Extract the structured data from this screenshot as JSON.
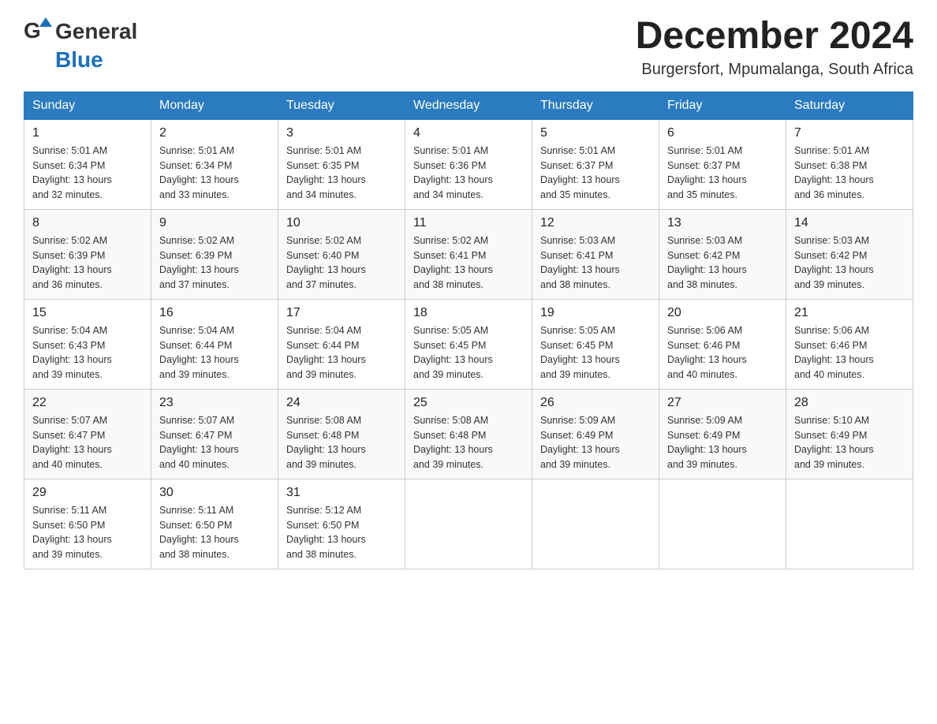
{
  "header": {
    "logo_general": "General",
    "logo_blue": "Blue",
    "month_title": "December 2024",
    "location": "Burgersfort, Mpumalanga, South Africa"
  },
  "weekdays": [
    "Sunday",
    "Monday",
    "Tuesday",
    "Wednesday",
    "Thursday",
    "Friday",
    "Saturday"
  ],
  "weeks": [
    [
      {
        "day": "1",
        "sunrise": "5:01 AM",
        "sunset": "6:34 PM",
        "daylight": "13 hours and 32 minutes."
      },
      {
        "day": "2",
        "sunrise": "5:01 AM",
        "sunset": "6:34 PM",
        "daylight": "13 hours and 33 minutes."
      },
      {
        "day": "3",
        "sunrise": "5:01 AM",
        "sunset": "6:35 PM",
        "daylight": "13 hours and 34 minutes."
      },
      {
        "day": "4",
        "sunrise": "5:01 AM",
        "sunset": "6:36 PM",
        "daylight": "13 hours and 34 minutes."
      },
      {
        "day": "5",
        "sunrise": "5:01 AM",
        "sunset": "6:37 PM",
        "daylight": "13 hours and 35 minutes."
      },
      {
        "day": "6",
        "sunrise": "5:01 AM",
        "sunset": "6:37 PM",
        "daylight": "13 hours and 35 minutes."
      },
      {
        "day": "7",
        "sunrise": "5:01 AM",
        "sunset": "6:38 PM",
        "daylight": "13 hours and 36 minutes."
      }
    ],
    [
      {
        "day": "8",
        "sunrise": "5:02 AM",
        "sunset": "6:39 PM",
        "daylight": "13 hours and 36 minutes."
      },
      {
        "day": "9",
        "sunrise": "5:02 AM",
        "sunset": "6:39 PM",
        "daylight": "13 hours and 37 minutes."
      },
      {
        "day": "10",
        "sunrise": "5:02 AM",
        "sunset": "6:40 PM",
        "daylight": "13 hours and 37 minutes."
      },
      {
        "day": "11",
        "sunrise": "5:02 AM",
        "sunset": "6:41 PM",
        "daylight": "13 hours and 38 minutes."
      },
      {
        "day": "12",
        "sunrise": "5:03 AM",
        "sunset": "6:41 PM",
        "daylight": "13 hours and 38 minutes."
      },
      {
        "day": "13",
        "sunrise": "5:03 AM",
        "sunset": "6:42 PM",
        "daylight": "13 hours and 38 minutes."
      },
      {
        "day": "14",
        "sunrise": "5:03 AM",
        "sunset": "6:42 PM",
        "daylight": "13 hours and 39 minutes."
      }
    ],
    [
      {
        "day": "15",
        "sunrise": "5:04 AM",
        "sunset": "6:43 PM",
        "daylight": "13 hours and 39 minutes."
      },
      {
        "day": "16",
        "sunrise": "5:04 AM",
        "sunset": "6:44 PM",
        "daylight": "13 hours and 39 minutes."
      },
      {
        "day": "17",
        "sunrise": "5:04 AM",
        "sunset": "6:44 PM",
        "daylight": "13 hours and 39 minutes."
      },
      {
        "day": "18",
        "sunrise": "5:05 AM",
        "sunset": "6:45 PM",
        "daylight": "13 hours and 39 minutes."
      },
      {
        "day": "19",
        "sunrise": "5:05 AM",
        "sunset": "6:45 PM",
        "daylight": "13 hours and 39 minutes."
      },
      {
        "day": "20",
        "sunrise": "5:06 AM",
        "sunset": "6:46 PM",
        "daylight": "13 hours and 40 minutes."
      },
      {
        "day": "21",
        "sunrise": "5:06 AM",
        "sunset": "6:46 PM",
        "daylight": "13 hours and 40 minutes."
      }
    ],
    [
      {
        "day": "22",
        "sunrise": "5:07 AM",
        "sunset": "6:47 PM",
        "daylight": "13 hours and 40 minutes."
      },
      {
        "day": "23",
        "sunrise": "5:07 AM",
        "sunset": "6:47 PM",
        "daylight": "13 hours and 40 minutes."
      },
      {
        "day": "24",
        "sunrise": "5:08 AM",
        "sunset": "6:48 PM",
        "daylight": "13 hours and 39 minutes."
      },
      {
        "day": "25",
        "sunrise": "5:08 AM",
        "sunset": "6:48 PM",
        "daylight": "13 hours and 39 minutes."
      },
      {
        "day": "26",
        "sunrise": "5:09 AM",
        "sunset": "6:49 PM",
        "daylight": "13 hours and 39 minutes."
      },
      {
        "day": "27",
        "sunrise": "5:09 AM",
        "sunset": "6:49 PM",
        "daylight": "13 hours and 39 minutes."
      },
      {
        "day": "28",
        "sunrise": "5:10 AM",
        "sunset": "6:49 PM",
        "daylight": "13 hours and 39 minutes."
      }
    ],
    [
      {
        "day": "29",
        "sunrise": "5:11 AM",
        "sunset": "6:50 PM",
        "daylight": "13 hours and 39 minutes."
      },
      {
        "day": "30",
        "sunrise": "5:11 AM",
        "sunset": "6:50 PM",
        "daylight": "13 hours and 38 minutes."
      },
      {
        "day": "31",
        "sunrise": "5:12 AM",
        "sunset": "6:50 PM",
        "daylight": "13 hours and 38 minutes."
      },
      null,
      null,
      null,
      null
    ]
  ],
  "labels": {
    "sunrise": "Sunrise:",
    "sunset": "Sunset:",
    "daylight": "Daylight:"
  }
}
